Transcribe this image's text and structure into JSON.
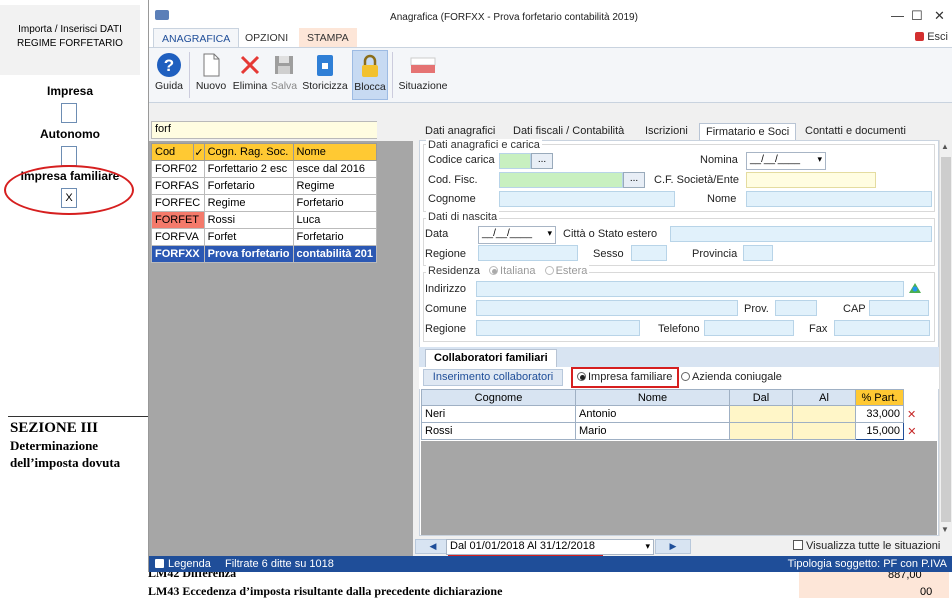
{
  "left_doc": {
    "header": "Importa / Inserisci DATI REGIME FORFETARIO",
    "impresa": "Impresa",
    "autonomo": "Autonomo",
    "impresa_familiare": "Impresa familiare",
    "impresa_familiare_mark": "X",
    "section_title": "SEZIONE III",
    "section_sub": "Determinazione dell’imposta dovuta"
  },
  "window": {
    "title": "Anagrafica (FORFXX - Prova forfetario contabilità 2019)",
    "minimize": "—",
    "maximize": "☐",
    "close": "✕",
    "esci": "Esci"
  },
  "ribbon": {
    "tabs": [
      "ANAGRAFICA",
      "OPZIONI",
      "STAMPA"
    ],
    "buttons": {
      "guida": "Guida",
      "nuovo": "Nuovo",
      "elimina": "Elimina",
      "salva": "Salva",
      "storicizza": "Storicizza",
      "blocca": "Blocca",
      "situazione": "Situazione"
    }
  },
  "list": {
    "search_value": "forf",
    "headers": [
      "Cod",
      "✓",
      "Cogn. Rag. Soc.",
      "Nome"
    ],
    "rows": [
      {
        "cod": "FORF02",
        "cogn": "Forfettario 2 esc",
        "nome": "esce dal 2016"
      },
      {
        "cod": "FORFAS",
        "cogn": "Forfetario",
        "nome": "Regime"
      },
      {
        "cod": "FORFEC",
        "cogn": "Regime",
        "nome": "Forfetario"
      },
      {
        "cod": "FORFET",
        "cogn": "Rossi",
        "nome": "Luca"
      },
      {
        "cod": "FORFVA",
        "cogn": "Forfet",
        "nome": "Forfetario"
      },
      {
        "cod": "FORFXX",
        "cogn": "Prova forfetario",
        "nome": "contabilità 201"
      }
    ]
  },
  "detail_tabs": [
    "Dati anagrafici",
    "Dati fiscali / Contabilità",
    "Iscrizioni",
    "Firmatario e Soci",
    "Contatti e documenti"
  ],
  "form": {
    "group_carica": "Dati anagrafici e carica",
    "codice_carica": "Codice carica",
    "nomina": "Nomina",
    "nomina_value": "__/__/____",
    "cod_fisc": "Cod. Fisc.",
    "cf_soc": "C.F. Società/Ente",
    "cognome": "Cognome",
    "nome": "Nome",
    "group_nascita": "Dati di nascita",
    "data": "Data",
    "data_value": "__/__/____",
    "citta": "Città o Stato estero",
    "regione": "Regione",
    "sesso": "Sesso",
    "provincia": "Provincia",
    "residenza": "Residenza",
    "italiana": "Italiana",
    "estera": "Estera",
    "indirizzo": "Indirizzo",
    "comune": "Comune",
    "prov": "Prov.",
    "cap": "CAP",
    "regione2": "Regione",
    "telefono": "Telefono",
    "fax": "Fax",
    "dots": "..."
  },
  "collaboratori": {
    "tab": "Collaboratori familiari",
    "insert_btn": "Inserimento collaboratori",
    "opt_impresa": "Impresa familiare",
    "opt_azienda": "Azienda coniugale",
    "headers": [
      "Cognome",
      "Nome",
      "Dal",
      "Al",
      "% Part."
    ],
    "rows": [
      {
        "cognome": "Neri",
        "nome": "Antonio",
        "dal": "",
        "al": "",
        "part": "33,000"
      },
      {
        "cognome": "Rossi",
        "nome": "Mario",
        "dal": "",
        "al": "",
        "part": "15,000"
      }
    ]
  },
  "bottom": {
    "period": "Dal 01/01/2018 Al 31/12/2018",
    "show_all": "Visualizza tutte le situazioni"
  },
  "status": {
    "legenda": "Legenda",
    "filtrate": "Filtrate 6 ditte su 1018",
    "tipologia": "Tipologia soggetto: PF con P.IVA"
  },
  "under": {
    "line1": "LM42 Differenza",
    "line2": "LM43 Eccedenza d’imposta risultante dalla precedente dichiarazione",
    "val1": "887,00",
    "val2": "00"
  },
  "colors": {
    "accent": "#1f4e99",
    "header_yellow": "#ffc933",
    "highlight_red": "#d61f1f"
  }
}
